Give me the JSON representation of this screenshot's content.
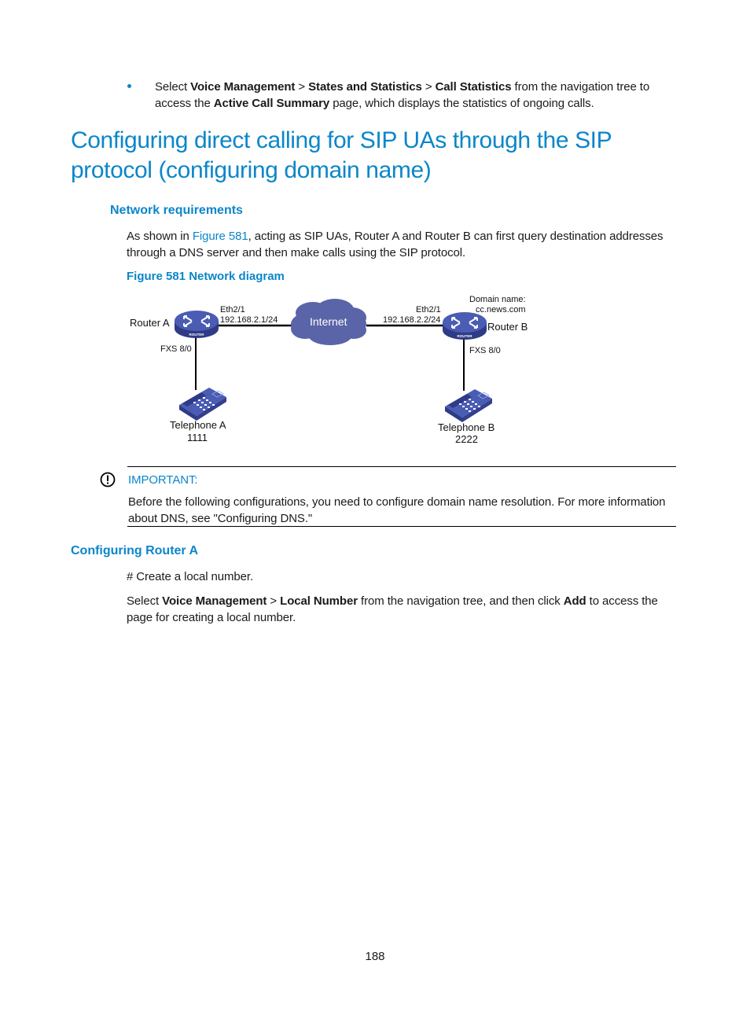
{
  "bullet": {
    "pre": "Select ",
    "b1": "Voice Management",
    "sep1": " > ",
    "b2": "States and Statistics",
    "sep2": " > ",
    "b3": "Call Statistics",
    "mid": " from the navigation tree to access the ",
    "b4": "Active Call Summary",
    "post": " page, which displays the statistics of ongoing calls."
  },
  "section_title": "Configuring direct calling for SIP UAs through the SIP protocol (configuring domain name)",
  "network_requirements": {
    "heading": "Network requirements",
    "para_pre": "As shown in ",
    "para_link": "Figure 581",
    "para_post": ", acting as SIP UAs, Router A and Router B can first query destination addresses through a DNS server and then make calls using the SIP protocol.",
    "figure_caption": "Figure 581 Network diagram"
  },
  "diagram": {
    "router_a": {
      "label": "Router A",
      "icon_text": "ROUTER",
      "interface": "Eth2/1",
      "ip": "192.168.2.1/24",
      "fxs": "FXS 8/0"
    },
    "router_b": {
      "label": "Router B",
      "icon_text": "ROUTER",
      "interface": "Eth2/1",
      "ip": "192.168.2.2/24",
      "fxs": "FXS 8/0",
      "domain_label": "Domain name:",
      "domain": "cc.news.com"
    },
    "cloud": "Internet",
    "telephone_a": {
      "label": "Telephone A",
      "number": "1111"
    },
    "telephone_b": {
      "label": "Telephone B",
      "number": "2222"
    },
    "colors": {
      "device": "#3f4fa0",
      "cloud": "#5a64a8",
      "line": "#000000"
    }
  },
  "important": {
    "label": "IMPORTANT:",
    "text": "Before the following configurations, you need to configure domain name resolution. For more information about DNS, see \"Configuring DNS.\""
  },
  "configuring_router_a": {
    "heading": "Configuring Router A",
    "step1": "# Create a local number.",
    "step2_pre": "Select ",
    "step2_b1": "Voice Management",
    "step2_sep": " > ",
    "step2_b2": "Local Number",
    "step2_mid": " from the navigation tree, and then click ",
    "step2_b3": "Add",
    "step2_post": " to access the page for creating a local number."
  },
  "page_number": "188"
}
